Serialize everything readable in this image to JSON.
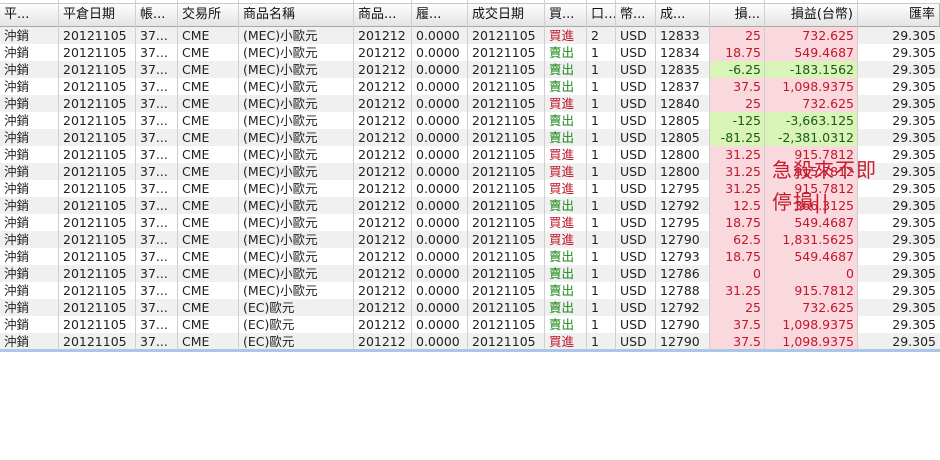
{
  "columns": [
    "平...",
    "平倉日期",
    "帳...",
    "交易所",
    "商品名稱",
    "商品...",
    "履...",
    "成交日期",
    "買...",
    "口...",
    "幣...",
    "成...",
    "損...",
    "損益(台幣)",
    "匯率"
  ],
  "rows": [
    [
      "沖銷",
      "20121105",
      "37...",
      "CME",
      "(MEC)小歐元",
      "201212",
      "0.0000",
      "20121105",
      "買進",
      "2",
      "USD",
      "12833",
      "25",
      "732.625",
      "29.305"
    ],
    [
      "沖銷",
      "20121105",
      "37...",
      "CME",
      "(MEC)小歐元",
      "201212",
      "0.0000",
      "20121105",
      "賣出",
      "1",
      "USD",
      "12834",
      "18.75",
      "549.4687",
      "29.305"
    ],
    [
      "沖銷",
      "20121105",
      "37...",
      "CME",
      "(MEC)小歐元",
      "201212",
      "0.0000",
      "20121105",
      "賣出",
      "1",
      "USD",
      "12835",
      "-6.25",
      "-183.1562",
      "29.305"
    ],
    [
      "沖銷",
      "20121105",
      "37...",
      "CME",
      "(MEC)小歐元",
      "201212",
      "0.0000",
      "20121105",
      "賣出",
      "1",
      "USD",
      "12837",
      "37.5",
      "1,098.9375",
      "29.305"
    ],
    [
      "沖銷",
      "20121105",
      "37...",
      "CME",
      "(MEC)小歐元",
      "201212",
      "0.0000",
      "20121105",
      "買進",
      "1",
      "USD",
      "12840",
      "25",
      "732.625",
      "29.305"
    ],
    [
      "沖銷",
      "20121105",
      "37...",
      "CME",
      "(MEC)小歐元",
      "201212",
      "0.0000",
      "20121105",
      "賣出",
      "1",
      "USD",
      "12805",
      "-125",
      "-3,663.125",
      "29.305"
    ],
    [
      "沖銷",
      "20121105",
      "37...",
      "CME",
      "(MEC)小歐元",
      "201212",
      "0.0000",
      "20121105",
      "賣出",
      "1",
      "USD",
      "12805",
      "-81.25",
      "-2,381.0312",
      "29.305"
    ],
    [
      "沖銷",
      "20121105",
      "37...",
      "CME",
      "(MEC)小歐元",
      "201212",
      "0.0000",
      "20121105",
      "買進",
      "1",
      "USD",
      "12800",
      "31.25",
      "915.7812",
      "29.305"
    ],
    [
      "沖銷",
      "20121105",
      "37...",
      "CME",
      "(MEC)小歐元",
      "201212",
      "0.0000",
      "20121105",
      "買進",
      "1",
      "USD",
      "12800",
      "31.25",
      "915.7812",
      "29.305"
    ],
    [
      "沖銷",
      "20121105",
      "37...",
      "CME",
      "(MEC)小歐元",
      "201212",
      "0.0000",
      "20121105",
      "買進",
      "1",
      "USD",
      "12795",
      "31.25",
      "915.7812",
      "29.305"
    ],
    [
      "沖銷",
      "20121105",
      "37...",
      "CME",
      "(MEC)小歐元",
      "201212",
      "0.0000",
      "20121105",
      "賣出",
      "1",
      "USD",
      "12792",
      "12.5",
      "366.3125",
      "29.305"
    ],
    [
      "沖銷",
      "20121105",
      "37...",
      "CME",
      "(MEC)小歐元",
      "201212",
      "0.0000",
      "20121105",
      "買進",
      "1",
      "USD",
      "12795",
      "18.75",
      "549.4687",
      "29.305"
    ],
    [
      "沖銷",
      "20121105",
      "37...",
      "CME",
      "(MEC)小歐元",
      "201212",
      "0.0000",
      "20121105",
      "買進",
      "1",
      "USD",
      "12790",
      "62.5",
      "1,831.5625",
      "29.305"
    ],
    [
      "沖銷",
      "20121105",
      "37...",
      "CME",
      "(MEC)小歐元",
      "201212",
      "0.0000",
      "20121105",
      "賣出",
      "1",
      "USD",
      "12793",
      "18.75",
      "549.4687",
      "29.305"
    ],
    [
      "沖銷",
      "20121105",
      "37...",
      "CME",
      "(MEC)小歐元",
      "201212",
      "0.0000",
      "20121105",
      "賣出",
      "1",
      "USD",
      "12786",
      "0",
      "0",
      "29.305"
    ],
    [
      "沖銷",
      "20121105",
      "37...",
      "CME",
      "(MEC)小歐元",
      "201212",
      "0.0000",
      "20121105",
      "賣出",
      "1",
      "USD",
      "12788",
      "31.25",
      "915.7812",
      "29.305"
    ],
    [
      "沖銷",
      "20121105",
      "37...",
      "CME",
      "(EC)歐元",
      "201212",
      "0.0000",
      "20121105",
      "賣出",
      "1",
      "USD",
      "12792",
      "25",
      "732.625",
      "29.305"
    ],
    [
      "沖銷",
      "20121105",
      "37...",
      "CME",
      "(EC)歐元",
      "201212",
      "0.0000",
      "20121105",
      "賣出",
      "1",
      "USD",
      "12790",
      "37.5",
      "1,098.9375",
      "29.305"
    ],
    [
      "沖銷",
      "20121105",
      "37...",
      "CME",
      "(EC)歐元",
      "201212",
      "0.0000",
      "20121105",
      "買進",
      "1",
      "USD",
      "12790",
      "37.5",
      "1,098.9375",
      "29.305"
    ]
  ],
  "annotation": {
    "line1": "急殺來不即",
    "line2": "停損||"
  },
  "colors": {
    "buy": "#c0182a",
    "sell": "#1e8a1e",
    "profit_bg": "#f9d8de",
    "loss_bg": "#d8f4b6",
    "annotation": "#c81b2f"
  }
}
